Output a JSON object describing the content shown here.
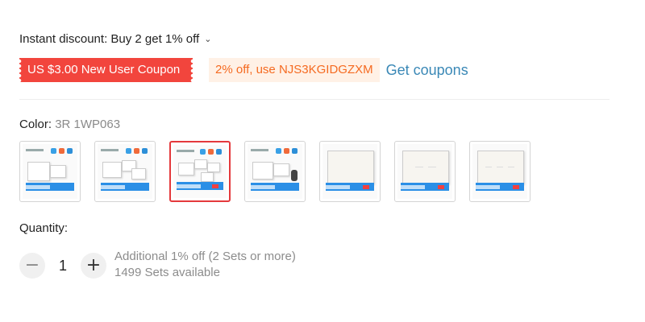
{
  "discount": {
    "text": "Instant discount: Buy 2 get 1% off",
    "chevron": "chevron-down-icon"
  },
  "coupons": {
    "new_user": "US $3.00 New User Coupon",
    "code_offer": "2% off, use NJS3KGIDGZXM",
    "get_link": "Get coupons"
  },
  "color": {
    "label": "Color: ",
    "selected_value": "3R 1WP063",
    "swatches": [
      {
        "selected": false
      },
      {
        "selected": false
      },
      {
        "selected": true
      },
      {
        "selected": false
      },
      {
        "selected": false
      },
      {
        "selected": false
      },
      {
        "selected": false
      }
    ]
  },
  "quantity": {
    "label": "Quantity:",
    "value": "1",
    "minus": "−",
    "plus": "+",
    "offer": "Additional 1% off (2 Sets or more)",
    "available": "1499 Sets available"
  },
  "colors": {
    "red_coupon": "#f2453d",
    "orange_text": "#f56a20",
    "orange_bg": "#fff1e6",
    "link_blue": "#3a88b6",
    "selected_border": "#e4393c"
  }
}
